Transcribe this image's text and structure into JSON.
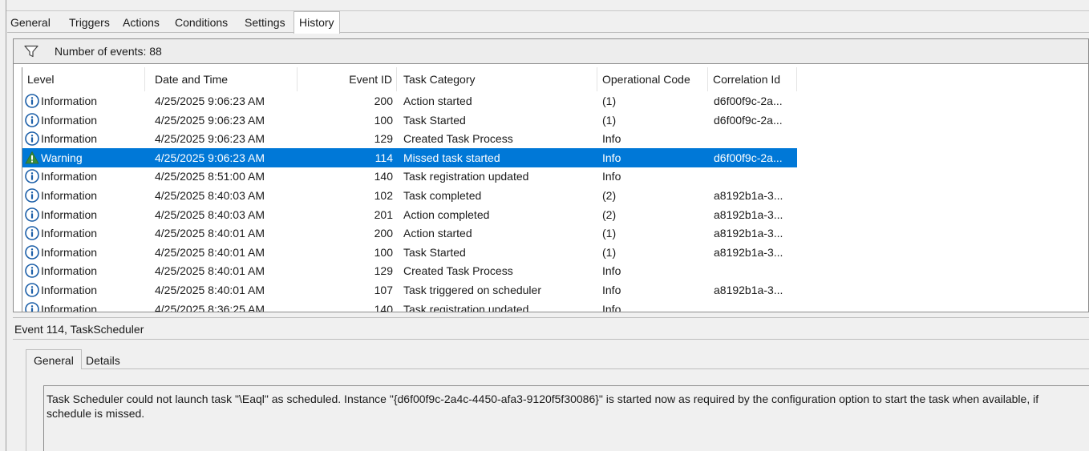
{
  "tabs": [
    {
      "label": "General",
      "active": false
    },
    {
      "label": "Triggers",
      "active": false
    },
    {
      "label": "Actions",
      "active": false
    },
    {
      "label": "Conditions",
      "active": false
    },
    {
      "label": "Settings",
      "active": false
    },
    {
      "label": "History",
      "active": true
    }
  ],
  "filter": {
    "icon": "filter-funnel-icon",
    "count_text": "Number of events: 88"
  },
  "table": {
    "columns": [
      "Level",
      "Date and Time",
      "Event ID",
      "Task Category",
      "Operational Code",
      "Correlation Id"
    ],
    "rows": [
      {
        "level": "Information",
        "icon": "information-icon",
        "date": "4/25/2025 9:06:23 AM",
        "event_id": "200",
        "category": "Action started",
        "op_code": "(1)",
        "correlation": "d6f00f9c-2a...",
        "selected": false
      },
      {
        "level": "Information",
        "icon": "information-icon",
        "date": "4/25/2025 9:06:23 AM",
        "event_id": "100",
        "category": "Task Started",
        "op_code": "(1)",
        "correlation": "d6f00f9c-2a...",
        "selected": false
      },
      {
        "level": "Information",
        "icon": "information-icon",
        "date": "4/25/2025 9:06:23 AM",
        "event_id": "129",
        "category": "Created Task Process",
        "op_code": "Info",
        "correlation": "",
        "selected": false
      },
      {
        "level": "Warning",
        "icon": "warning-icon",
        "date": "4/25/2025 9:06:23 AM",
        "event_id": "114",
        "category": "Missed task started",
        "op_code": "Info",
        "correlation": "d6f00f9c-2a...",
        "selected": true
      },
      {
        "level": "Information",
        "icon": "information-icon",
        "date": "4/25/2025 8:51:00 AM",
        "event_id": "140",
        "category": "Task registration updated",
        "op_code": "Info",
        "correlation": "",
        "selected": false
      },
      {
        "level": "Information",
        "icon": "information-icon",
        "date": "4/25/2025 8:40:03 AM",
        "event_id": "102",
        "category": "Task completed",
        "op_code": "(2)",
        "correlation": "a8192b1a-3...",
        "selected": false
      },
      {
        "level": "Information",
        "icon": "information-icon",
        "date": "4/25/2025 8:40:03 AM",
        "event_id": "201",
        "category": "Action completed",
        "op_code": "(2)",
        "correlation": "a8192b1a-3...",
        "selected": false
      },
      {
        "level": "Information",
        "icon": "information-icon",
        "date": "4/25/2025 8:40:01 AM",
        "event_id": "200",
        "category": "Action started",
        "op_code": "(1)",
        "correlation": "a8192b1a-3...",
        "selected": false
      },
      {
        "level": "Information",
        "icon": "information-icon",
        "date": "4/25/2025 8:40:01 AM",
        "event_id": "100",
        "category": "Task Started",
        "op_code": "(1)",
        "correlation": "a8192b1a-3...",
        "selected": false
      },
      {
        "level": "Information",
        "icon": "information-icon",
        "date": "4/25/2025 8:40:01 AM",
        "event_id": "129",
        "category": "Created Task Process",
        "op_code": "Info",
        "correlation": "",
        "selected": false
      },
      {
        "level": "Information",
        "icon": "information-icon",
        "date": "4/25/2025 8:40:01 AM",
        "event_id": "107",
        "category": "Task triggered on scheduler",
        "op_code": "Info",
        "correlation": "a8192b1a-3...",
        "selected": false
      },
      {
        "level": "Information",
        "icon": "information-icon",
        "date": "4/25/2025 8:36:25 AM",
        "event_id": "140",
        "category": "Task registration updated",
        "op_code": "Info",
        "correlation": "",
        "selected": false
      }
    ]
  },
  "event_detail": {
    "header": "Event 114, TaskScheduler",
    "tabs": [
      {
        "label": "General",
        "active": true
      },
      {
        "label": "Details",
        "active": false
      }
    ],
    "message": "Task Scheduler could not launch task \"\\Eaql\"  as scheduled. Instance \"{d6f00f9c-2a4c-4450-afa3-9120f5f30086}\"  is started now as required by the configuration option to start the task when available, if schedule is missed."
  },
  "colors": {
    "selection": "#0078d7",
    "info_icon": "#1c5fa8",
    "warning_icon": "#3a8a3a"
  }
}
